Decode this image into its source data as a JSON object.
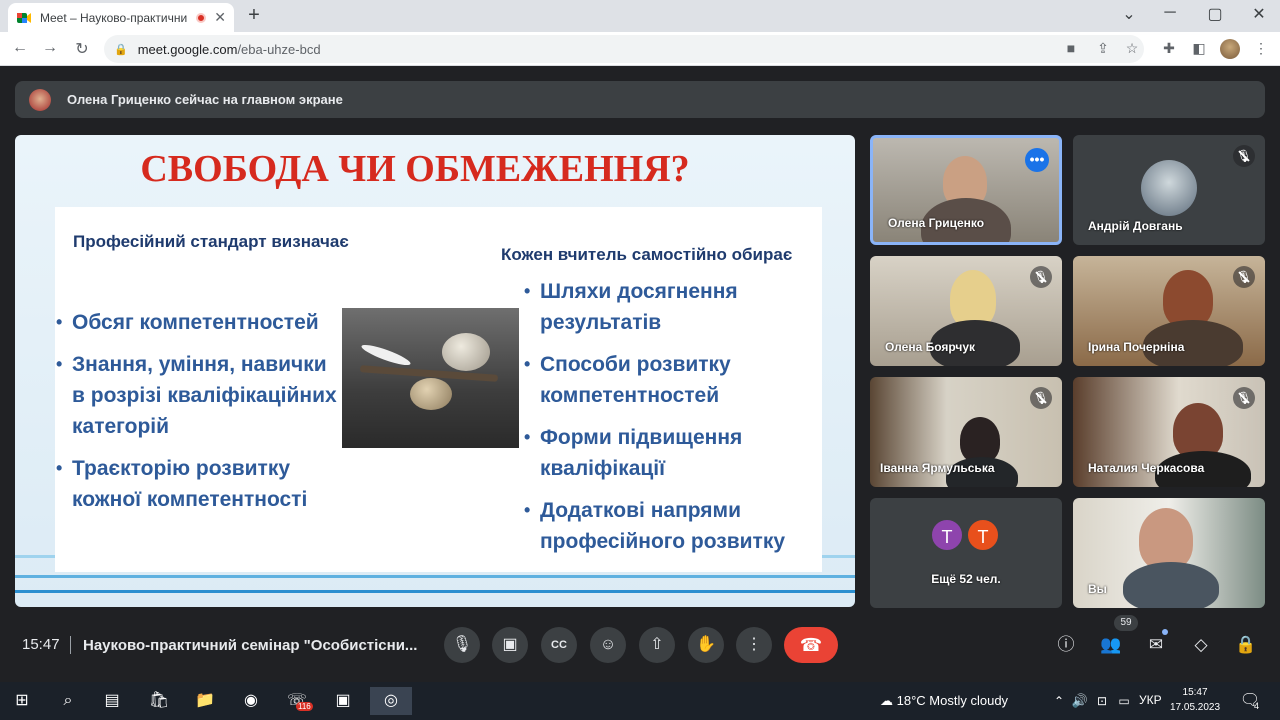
{
  "browser": {
    "tab_title": "Meet – Науково-практичний",
    "tab_close": "✕",
    "new_tab": "+",
    "window_controls": {
      "minimize": "─",
      "maximize": "▢",
      "close": "✕",
      "tab_search": "⌄"
    },
    "url_host": "meet.google.com",
    "url_path": "/eba-uhze-bcd",
    "nav": {
      "back": "←",
      "forward": "→",
      "reload": "↻"
    },
    "toolbar_icons": [
      "camera-icon",
      "share-icon",
      "star-icon",
      "extensions-icon",
      "sidepanel-icon",
      "menu-icon"
    ]
  },
  "banner": {
    "text": "Олена Гриценко сейчас на главном экране"
  },
  "slide": {
    "title": "СВОБОДА ЧИ ОБМЕЖЕННЯ?",
    "left_heading": "Професійний стандарт визначає",
    "left_items": [
      "Обсяг компетентностей",
      "Знання, уміння, навички в розрізі кваліфікаційних категорій",
      "Траєкторію розвитку кожної компетентності"
    ],
    "right_heading": "Кожен вчитель самостійно обирає",
    "right_items": [
      "Шляхи досягнення результатів",
      "Способи розвитку компетентностей",
      "Форми підвищення кваліфікації",
      "Додаткові напрями професійного розвитку"
    ]
  },
  "participants": [
    {
      "name": "Олена Гриценко",
      "speaking": true
    },
    {
      "name": "Андрій Довгань",
      "muted": true
    },
    {
      "name": "Олена Боярчук",
      "muted": true
    },
    {
      "name": "Ірина Почерніна",
      "muted": true
    },
    {
      "name": "Іванна Ярмульська",
      "muted": true
    },
    {
      "name": "Наталия Черкасова",
      "muted": true
    },
    {
      "name": "Вы"
    }
  ],
  "more_tile": {
    "avatars": [
      "Т",
      "Т"
    ],
    "avatar_colors": [
      "#8e44ad",
      "#e8501c"
    ],
    "label": "Ещё 52 чел."
  },
  "controls": {
    "time": "15:47",
    "meeting_title": "Науково-практичний семінар \"Особистісни...",
    "people_count": "59",
    "hangup_icon": "☎",
    "colors": {
      "hangup": "#ea4335",
      "accent": "#8ab4f8"
    }
  },
  "taskbar": {
    "weather_temp": "18°C",
    "weather_text": "Mostly cloudy",
    "language": "УКР",
    "time": "15:47",
    "date": "17.05.2023",
    "notifications": "4",
    "viber_badge": "116"
  }
}
